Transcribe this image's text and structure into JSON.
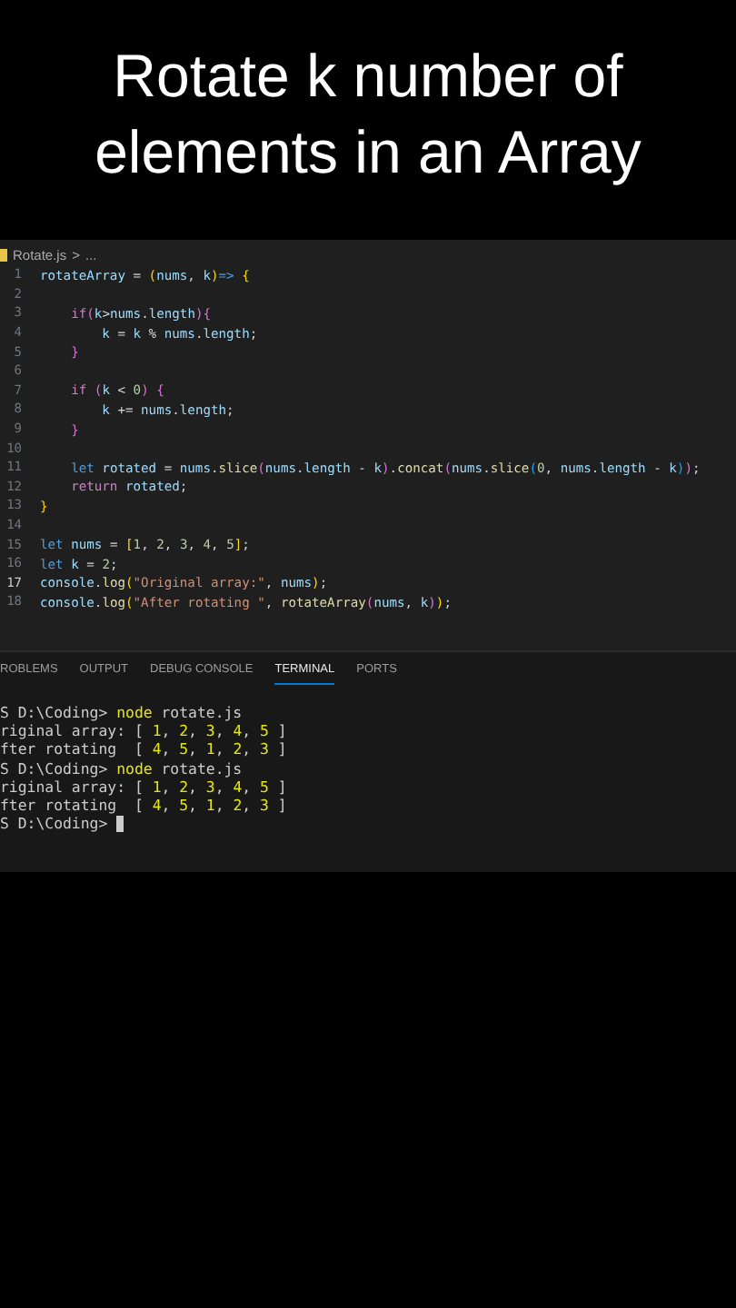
{
  "title": "Rotate k number of elements in an Array",
  "breadcrumb": {
    "file": "Rotate.js",
    "separator": ">",
    "trail": "..."
  },
  "code_lines": [
    {
      "number": "1",
      "current": false,
      "tokens": [
        {
          "text": "rotateArray",
          "kind": "var"
        },
        {
          "text": " = ",
          "kind": "op"
        },
        {
          "text": "(",
          "kind": "b1"
        },
        {
          "text": "nums",
          "kind": "var"
        },
        {
          "text": ", ",
          "kind": "op"
        },
        {
          "text": "k",
          "kind": "var"
        },
        {
          "text": ")",
          "kind": "b1"
        },
        {
          "text": "=> ",
          "kind": "kw"
        },
        {
          "text": "{",
          "kind": "b1"
        }
      ]
    },
    {
      "number": "2",
      "current": false
    },
    {
      "number": "3",
      "current": false,
      "tokens": [
        {
          "text": "    if",
          "kind": "ctl"
        },
        {
          "text": "(",
          "kind": "b2"
        },
        {
          "text": "k",
          "kind": "var"
        },
        {
          "text": ">",
          "kind": "op"
        },
        {
          "text": "nums",
          "kind": "var"
        },
        {
          "text": ".",
          "kind": "op"
        },
        {
          "text": "length",
          "kind": "var"
        },
        {
          "text": ")",
          "kind": "b2"
        },
        {
          "text": "{",
          "kind": "b2"
        }
      ]
    },
    {
      "number": "4",
      "current": false,
      "tokens": [
        {
          "text": "        k",
          "kind": "var"
        },
        {
          "text": " = ",
          "kind": "op"
        },
        {
          "text": "k",
          "kind": "var"
        },
        {
          "text": " % ",
          "kind": "op"
        },
        {
          "text": "nums",
          "kind": "var"
        },
        {
          "text": ".",
          "kind": "op"
        },
        {
          "text": "length",
          "kind": "var"
        },
        {
          "text": ";",
          "kind": "op"
        }
      ]
    },
    {
      "number": "5",
      "current": false,
      "tokens": [
        {
          "text": "    }",
          "kind": "b2"
        }
      ]
    },
    {
      "number": "6",
      "current": false
    },
    {
      "number": "7",
      "current": false,
      "tokens": [
        {
          "text": "    if ",
          "kind": "ctl"
        },
        {
          "text": "(",
          "kind": "b2"
        },
        {
          "text": "k",
          "kind": "var"
        },
        {
          "text": " < ",
          "kind": "op"
        },
        {
          "text": "0",
          "kind": "num"
        },
        {
          "text": ")",
          "kind": "b2"
        },
        {
          "text": " {",
          "kind": "b2"
        }
      ]
    },
    {
      "number": "8",
      "current": false,
      "tokens": [
        {
          "text": "        k",
          "kind": "var"
        },
        {
          "text": " += ",
          "kind": "op"
        },
        {
          "text": "nums",
          "kind": "var"
        },
        {
          "text": ".",
          "kind": "op"
        },
        {
          "text": "length",
          "kind": "var"
        },
        {
          "text": ";",
          "kind": "op"
        }
      ]
    },
    {
      "number": "9",
      "current": false,
      "tokens": [
        {
          "text": "    }",
          "kind": "b2"
        }
      ]
    },
    {
      "number": "10",
      "current": false
    },
    {
      "number": "11",
      "current": false,
      "tokens": [
        {
          "text": "    let ",
          "kind": "kw"
        },
        {
          "text": "rotated",
          "kind": "var"
        },
        {
          "text": " = ",
          "kind": "op"
        },
        {
          "text": "nums",
          "kind": "var"
        },
        {
          "text": ".",
          "kind": "op"
        },
        {
          "text": "slice",
          "kind": "fn"
        },
        {
          "text": "(",
          "kind": "b2"
        },
        {
          "text": "nums",
          "kind": "var"
        },
        {
          "text": ".",
          "kind": "op"
        },
        {
          "text": "length",
          "kind": "var"
        },
        {
          "text": " - ",
          "kind": "op"
        },
        {
          "text": "k",
          "kind": "var"
        },
        {
          "text": ")",
          "kind": "b2"
        },
        {
          "text": ".",
          "kind": "op"
        },
        {
          "text": "concat",
          "kind": "fn"
        },
        {
          "text": "(",
          "kind": "b2"
        },
        {
          "text": "nums",
          "kind": "var"
        },
        {
          "text": ".",
          "kind": "op"
        },
        {
          "text": "slice",
          "kind": "fn"
        },
        {
          "text": "(",
          "kind": "b3"
        },
        {
          "text": "0",
          "kind": "num"
        },
        {
          "text": ", ",
          "kind": "op"
        },
        {
          "text": "nums",
          "kind": "var"
        },
        {
          "text": ".",
          "kind": "op"
        },
        {
          "text": "length",
          "kind": "var"
        },
        {
          "text": " - ",
          "kind": "op"
        },
        {
          "text": "k",
          "kind": "var"
        },
        {
          "text": ")",
          "kind": "b3"
        },
        {
          "text": ")",
          "kind": "b2"
        },
        {
          "text": ";",
          "kind": "op"
        }
      ]
    },
    {
      "number": "12",
      "current": false,
      "tokens": [
        {
          "text": "    return ",
          "kind": "ctl"
        },
        {
          "text": "rotated",
          "kind": "var"
        },
        {
          "text": ";",
          "kind": "op"
        }
      ]
    },
    {
      "number": "13",
      "current": false,
      "tokens": [
        {
          "text": "}",
          "kind": "b1"
        }
      ]
    },
    {
      "number": "14",
      "current": false
    },
    {
      "number": "15",
      "current": false,
      "tokens": [
        {
          "text": "let ",
          "kind": "kw"
        },
        {
          "text": "nums",
          "kind": "var"
        },
        {
          "text": " = ",
          "kind": "op"
        },
        {
          "text": "[",
          "kind": "b1"
        },
        {
          "text": "1",
          "kind": "num"
        },
        {
          "text": ", ",
          "kind": "op"
        },
        {
          "text": "2",
          "kind": "num"
        },
        {
          "text": ", ",
          "kind": "op"
        },
        {
          "text": "3",
          "kind": "num"
        },
        {
          "text": ", ",
          "kind": "op"
        },
        {
          "text": "4",
          "kind": "num"
        },
        {
          "text": ", ",
          "kind": "op"
        },
        {
          "text": "5",
          "kind": "num"
        },
        {
          "text": "]",
          "kind": "b1"
        },
        {
          "text": ";",
          "kind": "op"
        }
      ]
    },
    {
      "number": "16",
      "current": false,
      "tokens": [
        {
          "text": "let ",
          "kind": "kw"
        },
        {
          "text": "k",
          "kind": "var"
        },
        {
          "text": " = ",
          "kind": "op"
        },
        {
          "text": "2",
          "kind": "num"
        },
        {
          "text": ";",
          "kind": "op"
        }
      ]
    },
    {
      "number": "17",
      "current": true,
      "tokens": [
        {
          "text": "console",
          "kind": "var"
        },
        {
          "text": ".",
          "kind": "op"
        },
        {
          "text": "log",
          "kind": "fn"
        },
        {
          "text": "(",
          "kind": "b1"
        },
        {
          "text": "\"Original array:\"",
          "kind": "str"
        },
        {
          "text": ", ",
          "kind": "op"
        },
        {
          "text": "nums",
          "kind": "var"
        },
        {
          "text": ")",
          "kind": "b1"
        },
        {
          "text": ";",
          "kind": "op"
        }
      ]
    },
    {
      "number": "18",
      "current": false,
      "tokens": [
        {
          "text": "console",
          "kind": "var"
        },
        {
          "text": ".",
          "kind": "op"
        },
        {
          "text": "log",
          "kind": "fn"
        },
        {
          "text": "(",
          "kind": "b1"
        },
        {
          "text": "\"After rotating \"",
          "kind": "str"
        },
        {
          "text": ", ",
          "kind": "op"
        },
        {
          "text": "rotateArray",
          "kind": "fn"
        },
        {
          "text": "(",
          "kind": "b2"
        },
        {
          "text": "nums",
          "kind": "var"
        },
        {
          "text": ", ",
          "kind": "op"
        },
        {
          "text": "k",
          "kind": "var"
        },
        {
          "text": ")",
          "kind": "b2"
        },
        {
          "text": ")",
          "kind": "b1"
        },
        {
          "text": ";",
          "kind": "op"
        }
      ]
    }
  ],
  "panel_tabs": [
    {
      "label": "ROBLEMS",
      "selected": false
    },
    {
      "label": "OUTPUT",
      "selected": false
    },
    {
      "label": "DEBUG CONSOLE",
      "selected": false
    },
    {
      "label": "TERMINAL",
      "selected": true
    },
    {
      "label": "PORTS",
      "selected": false
    }
  ],
  "terminal_lines": [
    {
      "tokens": [
        {
          "text": "S D:\\Coding> ",
          "kind": "plain"
        },
        {
          "text": "node",
          "kind": "cmd"
        },
        {
          "text": " rotate.js",
          "kind": "plain"
        }
      ]
    },
    {
      "tokens": [
        {
          "text": "riginal array: [ ",
          "kind": "plain"
        },
        {
          "text": "1",
          "kind": "num"
        },
        {
          "text": ", ",
          "kind": "plain"
        },
        {
          "text": "2",
          "kind": "num"
        },
        {
          "text": ", ",
          "kind": "plain"
        },
        {
          "text": "3",
          "kind": "num"
        },
        {
          "text": ", ",
          "kind": "plain"
        },
        {
          "text": "4",
          "kind": "num"
        },
        {
          "text": ", ",
          "kind": "plain"
        },
        {
          "text": "5",
          "kind": "num"
        },
        {
          "text": " ]",
          "kind": "plain"
        }
      ]
    },
    {
      "tokens": [
        {
          "text": "fter rotating  [ ",
          "kind": "plain"
        },
        {
          "text": "4",
          "kind": "num"
        },
        {
          "text": ", ",
          "kind": "plain"
        },
        {
          "text": "5",
          "kind": "num"
        },
        {
          "text": ", ",
          "kind": "plain"
        },
        {
          "text": "1",
          "kind": "num"
        },
        {
          "text": ", ",
          "kind": "plain"
        },
        {
          "text": "2",
          "kind": "num"
        },
        {
          "text": ", ",
          "kind": "plain"
        },
        {
          "text": "3",
          "kind": "num"
        },
        {
          "text": " ]",
          "kind": "plain"
        }
      ]
    },
    {
      "tokens": [
        {
          "text": "S D:\\Coding> ",
          "kind": "plain"
        },
        {
          "text": "node",
          "kind": "cmd"
        },
        {
          "text": " rotate.js",
          "kind": "plain"
        }
      ]
    },
    {
      "tokens": [
        {
          "text": "riginal array: [ ",
          "kind": "plain"
        },
        {
          "text": "1",
          "kind": "num"
        },
        {
          "text": ", ",
          "kind": "plain"
        },
        {
          "text": "2",
          "kind": "num"
        },
        {
          "text": ", ",
          "kind": "plain"
        },
        {
          "text": "3",
          "kind": "num"
        },
        {
          "text": ", ",
          "kind": "plain"
        },
        {
          "text": "4",
          "kind": "num"
        },
        {
          "text": ", ",
          "kind": "plain"
        },
        {
          "text": "5",
          "kind": "num"
        },
        {
          "text": " ]",
          "kind": "plain"
        }
      ]
    },
    {
      "tokens": [
        {
          "text": "fter rotating  [ ",
          "kind": "plain"
        },
        {
          "text": "4",
          "kind": "num"
        },
        {
          "text": ", ",
          "kind": "plain"
        },
        {
          "text": "5",
          "kind": "num"
        },
        {
          "text": ", ",
          "kind": "plain"
        },
        {
          "text": "1",
          "kind": "num"
        },
        {
          "text": ", ",
          "kind": "plain"
        },
        {
          "text": "2",
          "kind": "num"
        },
        {
          "text": ", ",
          "kind": "plain"
        },
        {
          "text": "3",
          "kind": "num"
        },
        {
          "text": " ]",
          "kind": "plain"
        }
      ]
    },
    {
      "tokens": [
        {
          "text": "S D:\\Coding> ",
          "kind": "plain"
        }
      ]
    }
  ]
}
